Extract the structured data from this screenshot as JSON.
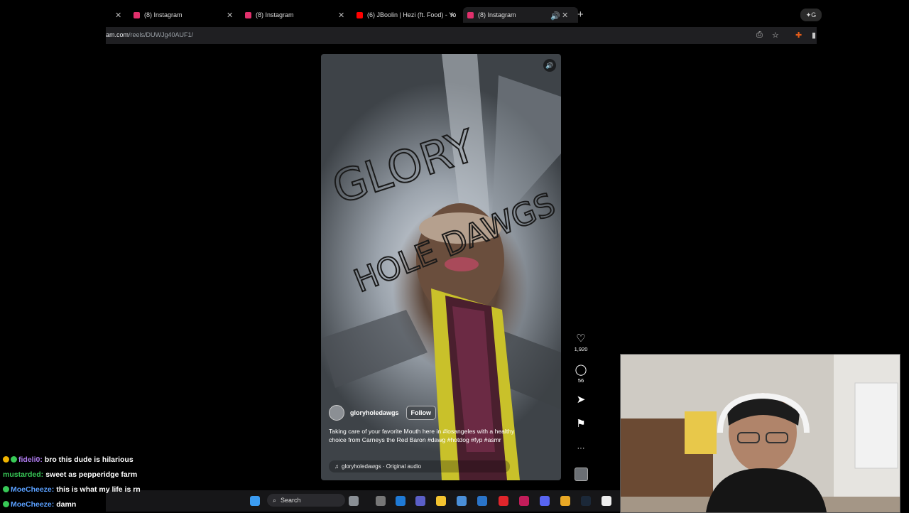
{
  "browser": {
    "tabs": [
      {
        "label": "(8) Instagram",
        "favicon": "instagram-icon",
        "color": "#e1306c"
      },
      {
        "label": "(8) Instagram",
        "favicon": "instagram-icon",
        "color": "#e1306c"
      },
      {
        "label": "(6) JBoolin | Hezi (ft. Food) - Yo",
        "favicon": "youtube-icon",
        "color": "#ff0000"
      },
      {
        "label": "(8) Instagram",
        "favicon": "instagram-icon",
        "color": "#e1306c"
      }
    ],
    "new_tab": "+",
    "gemini_label": "G",
    "url_host": "am.com",
    "url_path": "/reels/DUWJg40AUF1/"
  },
  "reel": {
    "art_text_1": "GLORY",
    "art_text_2": "HOLE DAWGS",
    "author": "gloryholedawgs",
    "follow_label": "Follow",
    "caption": "Taking care of your favorite Mouth here in #losangeles with a healthy choice from Carneys the Red Baron #dawg #hotdog #fyp #asmr",
    "audio": "gloryholedawgs · Original audio",
    "likes": "1,920",
    "comments": "56",
    "more": "···"
  },
  "taskbar": {
    "search_label": "Search"
  },
  "chat": [
    {
      "user": "fideli0:",
      "user_color": "#b07cf0",
      "text": "bro this dude is hilarious",
      "badges": [
        "#f0b400",
        "#38c957"
      ]
    },
    {
      "user": "mustarded:",
      "user_color": "#38c957",
      "text": "sweet as pepperidge farm",
      "badges": []
    },
    {
      "user": "MoeCheeze:",
      "user_color": "#5aa0ff",
      "text": "this is what my life is rn",
      "badges": [
        "#38c957"
      ]
    },
    {
      "user": "MoeCheeze:",
      "user_color": "#5aa0ff",
      "text": "damn",
      "badges": [
        "#38c957"
      ]
    }
  ],
  "colors": {
    "accent_instagram": "#e1306c",
    "youtube_red": "#ff0000"
  }
}
